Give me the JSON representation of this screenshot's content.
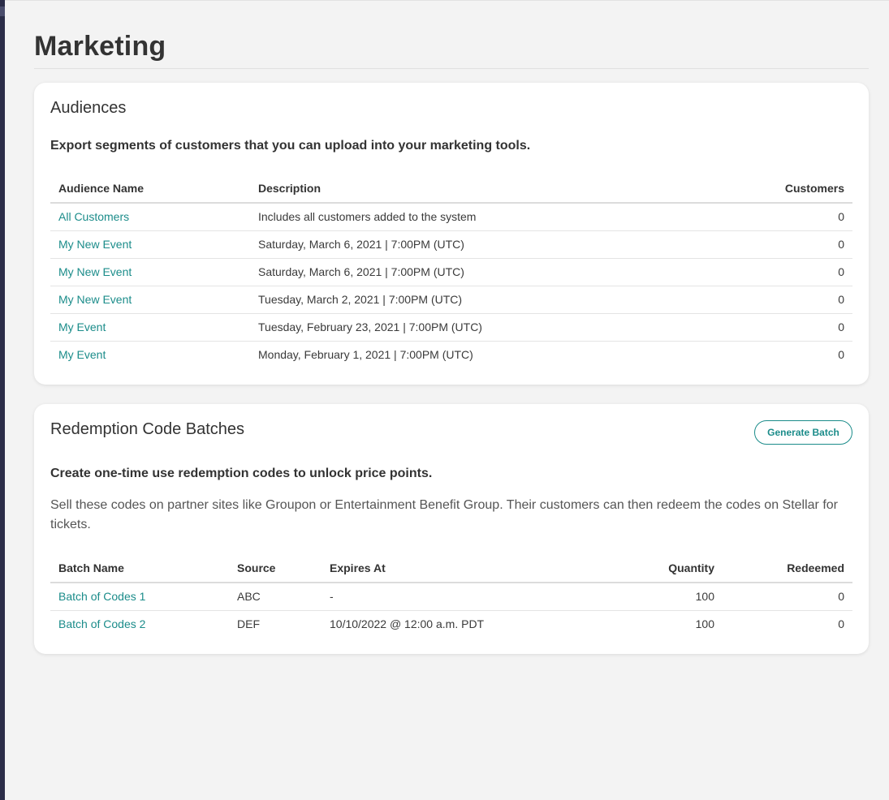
{
  "page": {
    "title": "Marketing"
  },
  "audiences": {
    "title": "Audiences",
    "subtitle": "Export segments of customers that you can upload into your marketing tools.",
    "columns": {
      "name": "Audience Name",
      "description": "Description",
      "customers": "Customers"
    },
    "rows": [
      {
        "name": "All Customers",
        "description": "Includes all customers added to the system",
        "customers": "0"
      },
      {
        "name": "My New Event",
        "description": "Saturday, March 6, 2021 | 7:00PM (UTC)",
        "customers": "0"
      },
      {
        "name": "My New Event",
        "description": "Saturday, March 6, 2021 | 7:00PM (UTC)",
        "customers": "0"
      },
      {
        "name": "My New Event",
        "description": "Tuesday, March 2, 2021 | 7:00PM (UTC)",
        "customers": "0"
      },
      {
        "name": "My Event",
        "description": "Tuesday, February 23, 2021 | 7:00PM (UTC)",
        "customers": "0"
      },
      {
        "name": "My Event",
        "description": "Monday, February 1, 2021 | 7:00PM (UTC)",
        "customers": "0"
      }
    ]
  },
  "batches": {
    "title": "Redemption Code Batches",
    "generate_label": "Generate Batch",
    "subtitle": "Create one-time use redemption codes to unlock price points.",
    "description": "Sell these codes on partner sites like Groupon or Entertainment Benefit Group. Their customers can then redeem the codes on Stellar for tickets.",
    "columns": {
      "name": "Batch Name",
      "source": "Source",
      "expires": "Expires At",
      "quantity": "Quantity",
      "redeemed": "Redeemed"
    },
    "rows": [
      {
        "name": "Batch of Codes 1",
        "source": "ABC",
        "expires": "-",
        "quantity": "100",
        "redeemed": "0"
      },
      {
        "name": "Batch of Codes 2",
        "source": "DEF",
        "expires": "10/10/2022 @ 12:00 a.m. PDT",
        "quantity": "100",
        "redeemed": "0"
      }
    ]
  },
  "colors": {
    "accent": "#1b8c8a",
    "rail": "#2b2d48",
    "background": "#f3f3f3"
  }
}
